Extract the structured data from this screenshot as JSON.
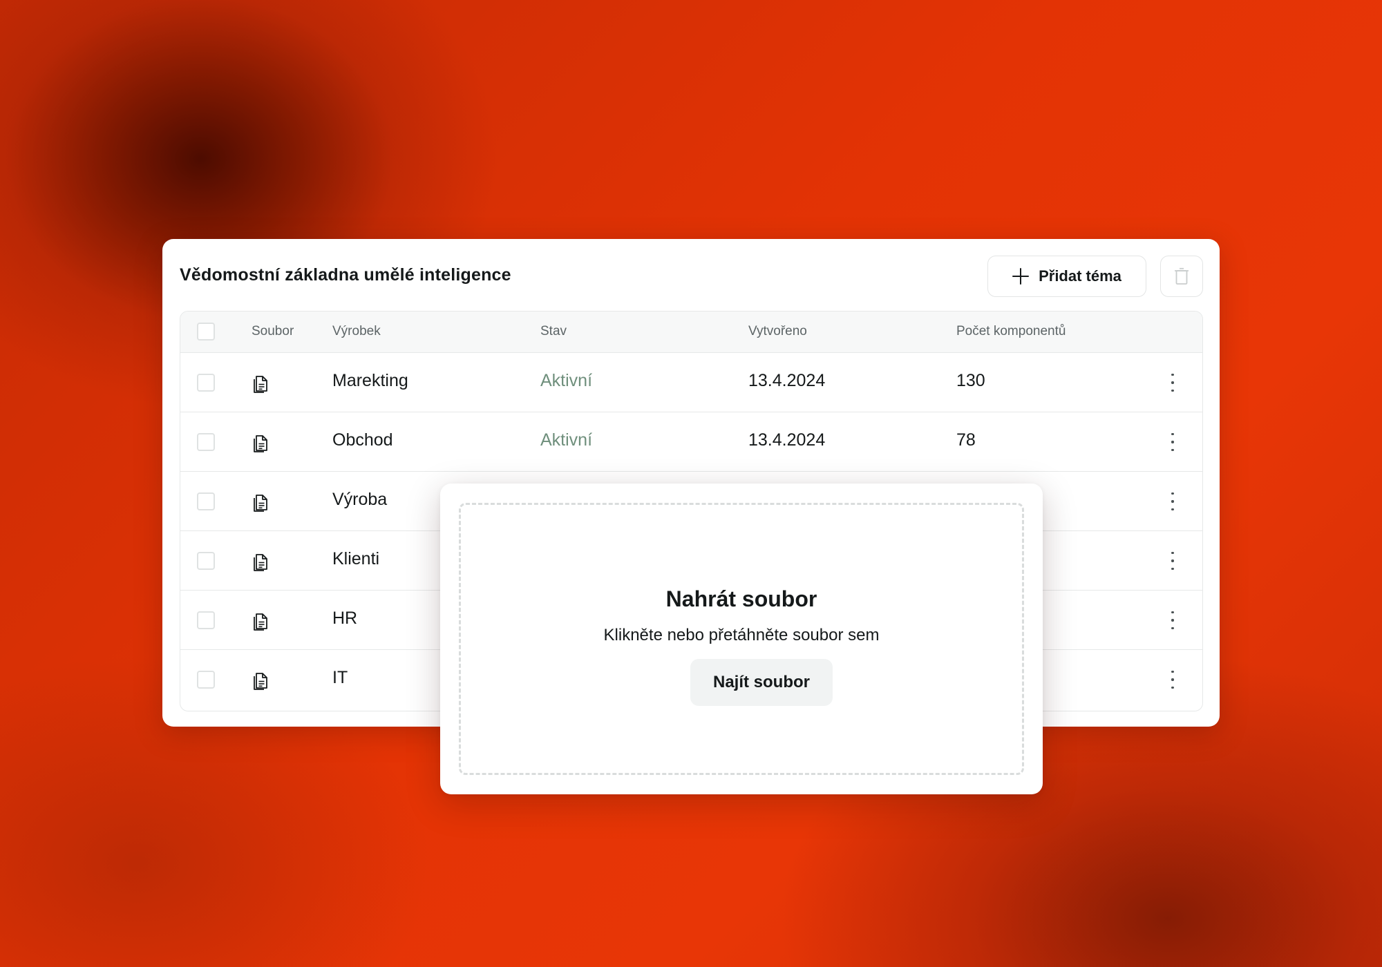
{
  "card": {
    "title": "Vědomostní základna umělé inteligence",
    "add_topic_label": "Přidat téma",
    "add_icon": "plus-icon",
    "delete_icon": "trash-icon"
  },
  "table": {
    "columns": [
      "Soubor",
      "Výrobek",
      "Stav",
      "Vytvořeno",
      "Počet komponentů"
    ],
    "rows": [
      {
        "product": "Marekting",
        "status": "Aktivní",
        "created": "13.4.2024",
        "components": "130"
      },
      {
        "product": "Obchod",
        "status": "Aktivní",
        "created": "13.4.2024",
        "components": "78"
      },
      {
        "product": "Výroba",
        "status": "",
        "created": "",
        "components": ""
      },
      {
        "product": "Klienti",
        "status": "",
        "created": "",
        "components": ""
      },
      {
        "product": "HR",
        "status": "",
        "created": "",
        "components": ""
      },
      {
        "product": "IT",
        "status": "",
        "created": "",
        "components": ""
      }
    ],
    "row_icon": "document-icon",
    "row_menu_icon": "more-vertical-icon"
  },
  "upload": {
    "title": "Nahrát soubor",
    "subtitle": "Klikněte nebo přetáhněte soubor sem",
    "button_label": "Najít soubor"
  },
  "colors": {
    "background_accent": "#e33305",
    "status_active": "#6f8f7c",
    "text_primary": "#15191a"
  }
}
